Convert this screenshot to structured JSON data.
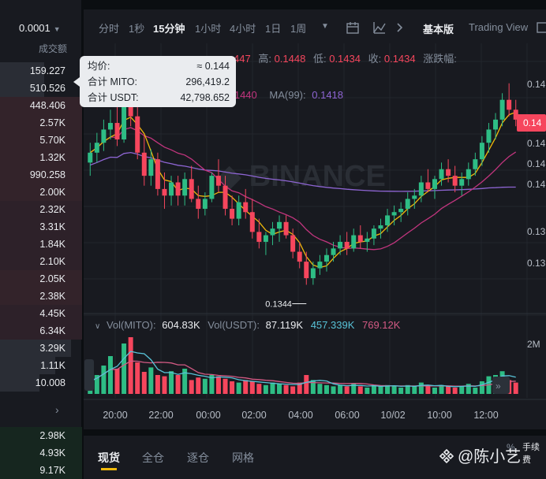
{
  "orderbook": {
    "precision": "0.0001",
    "header": "成交额",
    "rows": [
      "159.227",
      "510.526",
      "448.406",
      "2.57K",
      "5.70K",
      "1.32K",
      "990.258",
      "2.00K",
      "2.32K",
      "3.31K",
      "1.84K",
      "2.10K",
      "2.05K",
      "2.38K",
      "4.45K",
      "6.34K",
      "3.29K",
      "1.11K",
      "10.008"
    ],
    "bottom_rows": [
      "2.98K",
      "4.93K",
      "9.17K"
    ]
  },
  "toolbar": {
    "timeframes": [
      "分时",
      "1秒",
      "15分钟",
      "1小时",
      "4小时",
      "1日",
      "1周"
    ],
    "active": "15分钟",
    "views": [
      "基本版",
      "Trading View"
    ]
  },
  "tooltip": {
    "avg_label": "均价:",
    "avg_value": "≈ 0.144",
    "mito_label": "合计 MITO:",
    "mito_value": "296,419.2",
    "usdt_label": "合计 USDT:",
    "usdt_value": "42,798.652"
  },
  "ohlc": {
    "partial": "447",
    "high_label": "高:",
    "high": "0.1448",
    "low_label": "低:",
    "low": "0.1434",
    "close_label": "收:",
    "close": "0.1434",
    "change_label": "涨跌幅:"
  },
  "ma": {
    "ma25_partial": "0.1440",
    "ma99_label": "MA(99):",
    "ma99": "0.1418"
  },
  "volume_header": {
    "vol_mito_label": "Vol(MITO):",
    "vol_mito": "604.83K",
    "vol_usdt_label": "Vol(USDT):",
    "vol_usdt": "87.119K",
    "ma1": "457.339K",
    "ma2": "769.12K"
  },
  "price_axis": [
    "0.14",
    "0.14",
    "0.14",
    "0.14",
    "0.14",
    "0.13",
    "0.13"
  ],
  "price_badge": "0.14",
  "volume_axis": [
    "2M"
  ],
  "low_marker": "0.1344",
  "time_axis": [
    "20:00",
    "22:00",
    "00:00",
    "02:00",
    "04:00",
    "06:00",
    "10/02",
    "10:00",
    "12:00"
  ],
  "bottom_tabs": [
    "现货",
    "全仓",
    "逐仓",
    "网格"
  ],
  "bottom_right_partial": "%",
  "bottom_right_partial2": "手续费",
  "watermark": "@陈小艺",
  "colors": {
    "up": "#2ebd85",
    "down": "#f6465d",
    "ma7": "#f0b90b",
    "ma25": "#c2357e",
    "ma99": "#8e65d3",
    "accent": "#f0b90b",
    "vol_ma1": "#58c3d8",
    "vol_ma2": "#d35a84"
  },
  "chart_data": {
    "type": "candlestick",
    "interval": "15m",
    "x_ticks": [
      "20:00",
      "22:00",
      "00:00",
      "02:00",
      "04:00",
      "06:00",
      "10/02",
      "10:00",
      "12:00"
    ],
    "low_marker": 0.1344,
    "candles": [
      [
        0.1418,
        0.143,
        0.141,
        0.1424
      ],
      [
        0.1424,
        0.1436,
        0.1418,
        0.143
      ],
      [
        0.143,
        0.1444,
        0.1425,
        0.1438
      ],
      [
        0.1438,
        0.145,
        0.1432,
        0.1442
      ],
      [
        0.1442,
        0.1452,
        0.1428,
        0.1432
      ],
      [
        0.1432,
        0.1468,
        0.143,
        0.1462
      ],
      [
        0.1462,
        0.147,
        0.144,
        0.1446
      ],
      [
        0.1446,
        0.1452,
        0.142,
        0.1424
      ],
      [
        0.1424,
        0.1434,
        0.1404,
        0.141
      ],
      [
        0.141,
        0.1426,
        0.1404,
        0.142
      ],
      [
        0.142,
        0.1424,
        0.1398,
        0.1402
      ],
      [
        0.1402,
        0.1412,
        0.139,
        0.1398
      ],
      [
        0.1398,
        0.141,
        0.1392,
        0.1406
      ],
      [
        0.1406,
        0.141,
        0.1392,
        0.1398
      ],
      [
        0.1398,
        0.1412,
        0.1392,
        0.1408
      ],
      [
        0.1408,
        0.1416,
        0.1394,
        0.1396
      ],
      [
        0.1396,
        0.1404,
        0.1384,
        0.139
      ],
      [
        0.139,
        0.14,
        0.1386,
        0.1396
      ],
      [
        0.1396,
        0.1412,
        0.1394,
        0.141
      ],
      [
        0.141,
        0.142,
        0.14,
        0.1404
      ],
      [
        0.1404,
        0.141,
        0.1386,
        0.139
      ],
      [
        0.139,
        0.1398,
        0.138,
        0.1384
      ],
      [
        0.1384,
        0.1398,
        0.138,
        0.1394
      ],
      [
        0.1394,
        0.1402,
        0.1384,
        0.1388
      ],
      [
        0.1388,
        0.1396,
        0.1372,
        0.1376
      ],
      [
        0.1376,
        0.1384,
        0.1366,
        0.137
      ],
      [
        0.137,
        0.1376,
        0.1362,
        0.1374
      ],
      [
        0.1374,
        0.1382,
        0.1368,
        0.1378
      ],
      [
        0.1378,
        0.1386,
        0.137,
        0.1382
      ],
      [
        0.1382,
        0.1386,
        0.1372,
        0.1374
      ],
      [
        0.1374,
        0.1378,
        0.136,
        0.1364
      ],
      [
        0.1364,
        0.137,
        0.1354,
        0.1358
      ],
      [
        0.1358,
        0.1364,
        0.1344,
        0.1348
      ],
      [
        0.1348,
        0.1358,
        0.1344,
        0.1354
      ],
      [
        0.1354,
        0.1362,
        0.135,
        0.1358
      ],
      [
        0.1358,
        0.1366,
        0.1352,
        0.1362
      ],
      [
        0.1362,
        0.137,
        0.1358,
        0.1366
      ],
      [
        0.1366,
        0.1374,
        0.1362,
        0.137
      ],
      [
        0.137,
        0.1376,
        0.1362,
        0.1366
      ],
      [
        0.1366,
        0.1378,
        0.1364,
        0.1374
      ],
      [
        0.1374,
        0.138,
        0.1366,
        0.137
      ],
      [
        0.137,
        0.1376,
        0.1364,
        0.1372
      ],
      [
        0.1372,
        0.138,
        0.1368,
        0.1378
      ],
      [
        0.1378,
        0.1384,
        0.1372,
        0.138
      ],
      [
        0.138,
        0.139,
        0.1376,
        0.1386
      ],
      [
        0.1386,
        0.1392,
        0.138,
        0.1388
      ],
      [
        0.1388,
        0.1394,
        0.1382,
        0.139
      ],
      [
        0.139,
        0.14,
        0.1386,
        0.1396
      ],
      [
        0.1396,
        0.1402,
        0.139,
        0.1398
      ],
      [
        0.1398,
        0.141,
        0.1394,
        0.1406
      ],
      [
        0.1406,
        0.1414,
        0.14,
        0.1402
      ],
      [
        0.1402,
        0.141,
        0.1396,
        0.1408
      ],
      [
        0.1408,
        0.1418,
        0.1404,
        0.1414
      ],
      [
        0.1414,
        0.142,
        0.1406,
        0.141
      ],
      [
        0.141,
        0.1416,
        0.14,
        0.1404
      ],
      [
        0.1404,
        0.1412,
        0.1398,
        0.1408
      ],
      [
        0.1408,
        0.1418,
        0.1404,
        0.1414
      ],
      [
        0.1414,
        0.1424,
        0.141,
        0.142
      ],
      [
        0.142,
        0.1434,
        0.1416,
        0.143
      ],
      [
        0.143,
        0.1442,
        0.1424,
        0.1438
      ],
      [
        0.1438,
        0.1448,
        0.1432,
        0.1444
      ],
      [
        0.1444,
        0.146,
        0.144,
        0.1456
      ],
      [
        0.1456,
        0.1466,
        0.1446,
        0.145
      ],
      [
        0.145,
        0.1456,
        0.144,
        0.1444
      ]
    ],
    "volumes": [
      20,
      30,
      45,
      60,
      40,
      80,
      90,
      50,
      35,
      42,
      30,
      28,
      36,
      30,
      40,
      22,
      26,
      24,
      30,
      28,
      24,
      20,
      18,
      22,
      20,
      16,
      14,
      18,
      16,
      14,
      12,
      18,
      30,
      22,
      16,
      14,
      12,
      14,
      12,
      16,
      12,
      10,
      14,
      12,
      14,
      12,
      10,
      14,
      12,
      18,
      12,
      10,
      14,
      12,
      10,
      12,
      16,
      10,
      20,
      28,
      30,
      36,
      22,
      18
    ]
  }
}
